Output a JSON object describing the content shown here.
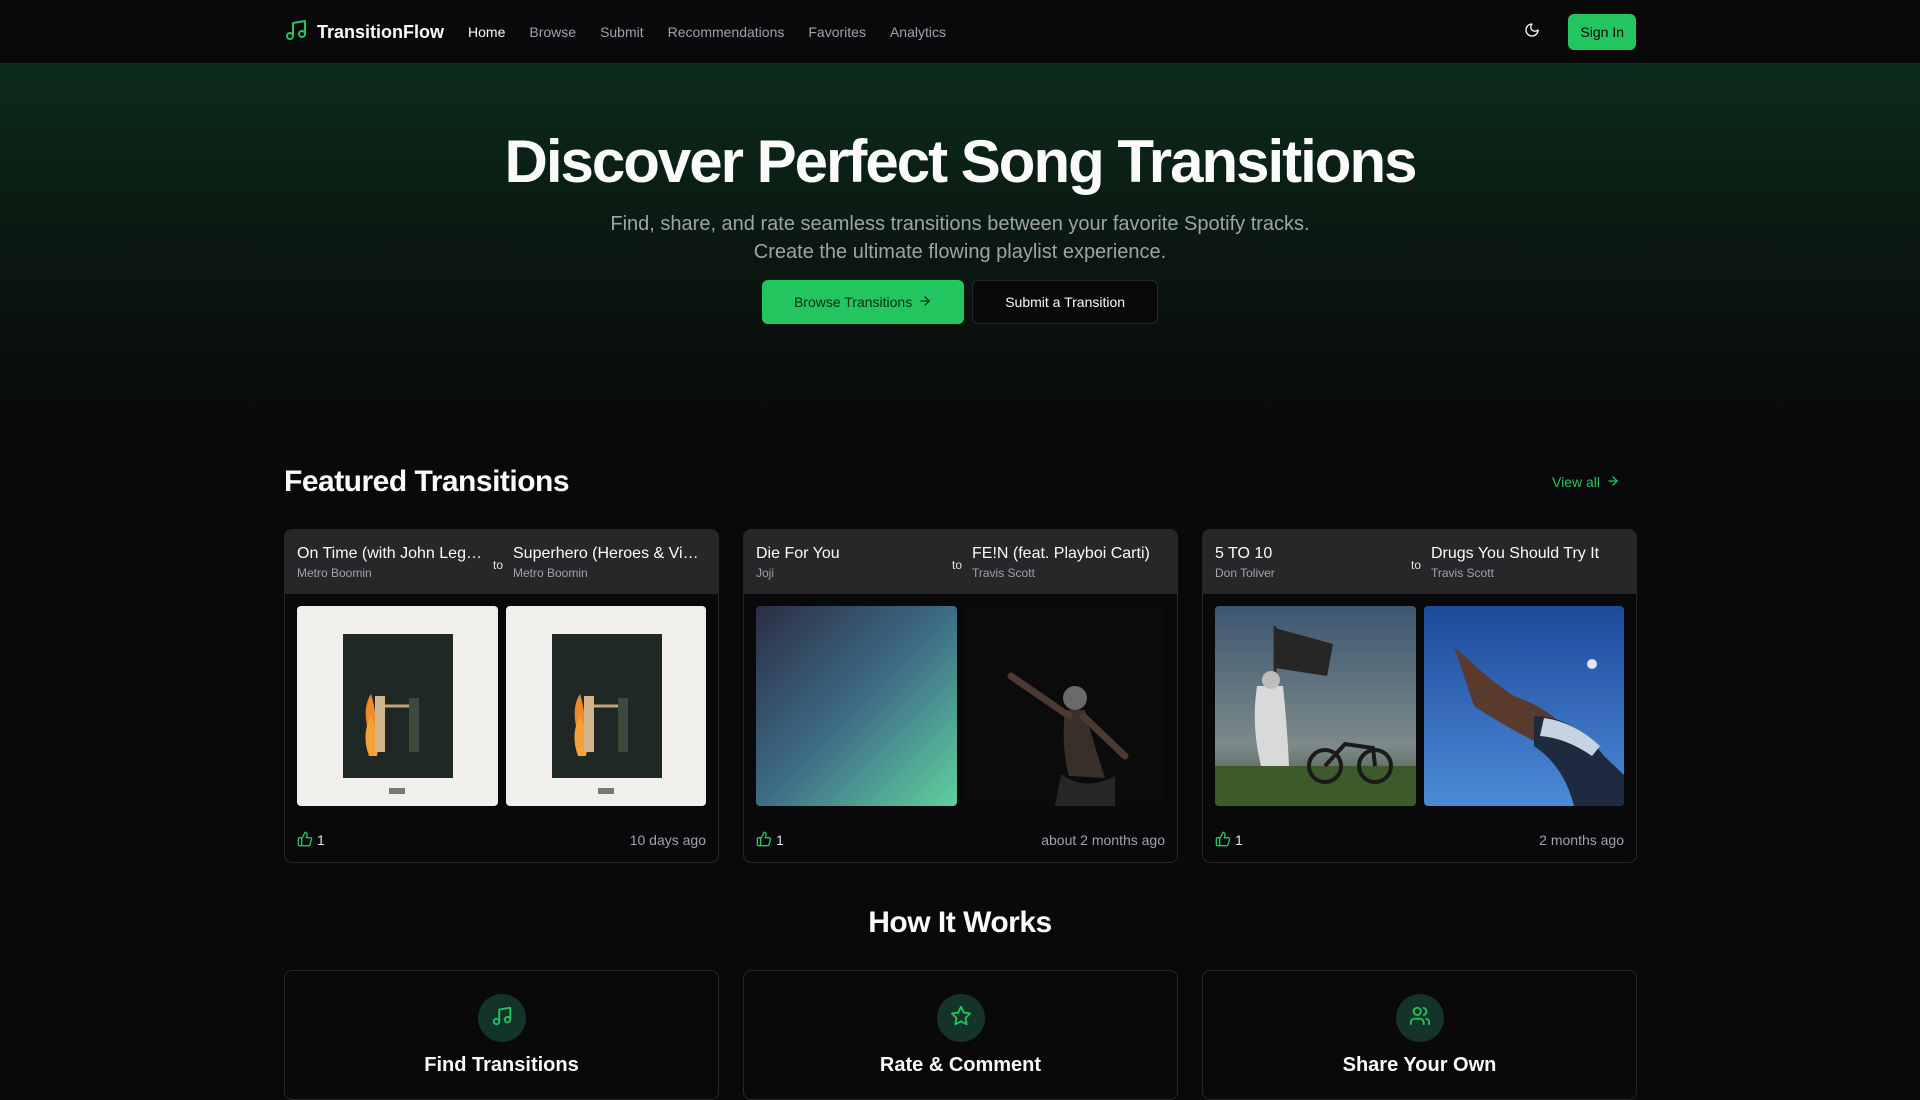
{
  "nav": {
    "brand": "TransitionFlow",
    "links": [
      "Home",
      "Browse",
      "Submit",
      "Recommendations",
      "Favorites",
      "Analytics"
    ],
    "active": "Home",
    "signin_label": "Sign In"
  },
  "hero": {
    "title": "Discover Perfect Song Transitions",
    "subtitle": "Find, share, and rate seamless transitions between your favorite Spotify tracks. Create the ultimate flowing playlist experience.",
    "primary_label": "Browse Transitions",
    "secondary_label": "Submit a Transition"
  },
  "featured": {
    "title": "Featured Transitions",
    "view_all_label": "View all",
    "to_label": "to",
    "cards": [
      {
        "from": {
          "name": "On Time (with John Legend)",
          "artist": "Metro Boomin"
        },
        "to": {
          "name": "Superhero (Heroes & Villains)",
          "artist": "Metro Boomin"
        },
        "likes": "1",
        "time": "10 days ago"
      },
      {
        "from": {
          "name": "Die For You",
          "artist": "Joji"
        },
        "to": {
          "name": "FE!N (feat. Playboi Carti)",
          "artist": "Travis Scott"
        },
        "likes": "1",
        "time": "about 2 months ago"
      },
      {
        "from": {
          "name": "5 TO 10",
          "artist": "Don Toliver"
        },
        "to": {
          "name": "Drugs You Should Try It",
          "artist": "Travis Scott"
        },
        "likes": "1",
        "time": "2 months ago"
      }
    ]
  },
  "how": {
    "title": "How It Works",
    "steps": [
      {
        "label": "Find Transitions",
        "icon": "music-note-icon"
      },
      {
        "label": "Rate & Comment",
        "icon": "star-icon"
      },
      {
        "label": "Share Your Own",
        "icon": "users-icon"
      }
    ]
  },
  "colors": {
    "accent": "#22c55e",
    "background": "#09090b",
    "card_header": "#27272a"
  }
}
